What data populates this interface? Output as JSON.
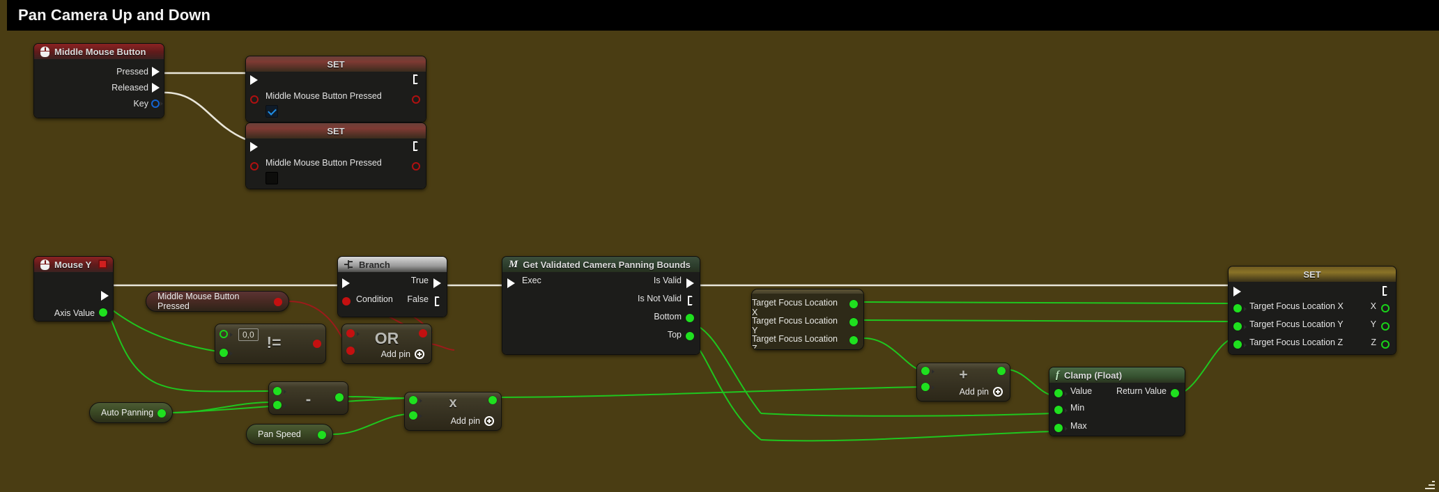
{
  "window": {
    "title": "Pan Camera Up and Down",
    "background_color": "#4a3d13",
    "titlebar_color": "#000000"
  },
  "graph": {
    "nodes": [
      {
        "id": "event-middle-mouse-button",
        "kind": "event",
        "title": "Middle Mouse Button",
        "icon": "mouse-icon",
        "outputs": [
          "Pressed",
          "Released",
          "Key"
        ]
      },
      {
        "id": "set-mmb-pressed-true",
        "kind": "set",
        "title": "SET",
        "variable": "Middle Mouse Button Pressed",
        "checkbox_state": "checked"
      },
      {
        "id": "set-mmb-pressed-false",
        "kind": "set",
        "title": "SET",
        "variable": "Middle Mouse Button Pressed",
        "checkbox_state": "unchecked"
      },
      {
        "id": "event-mouse-y",
        "kind": "event",
        "title": "Mouse Y",
        "icon": "mouse-icon",
        "badge": "stop-icon",
        "outputs": [
          "Axis Value"
        ]
      },
      {
        "id": "getter-mmb-pressed",
        "kind": "variable-get",
        "label": "Middle Mouse Button Pressed",
        "pin_color": "red"
      },
      {
        "id": "getter-auto-panning",
        "kind": "variable-get",
        "label": "Auto Panning",
        "pin_color": "green"
      },
      {
        "id": "getter-pan-speed",
        "kind": "variable-get",
        "label": "Pan Speed",
        "pin_color": "green"
      },
      {
        "id": "node-not-equal",
        "kind": "operator",
        "operator": "!=",
        "value_field": "0,0"
      },
      {
        "id": "node-or",
        "kind": "operator",
        "operator": "OR",
        "add_pin_label": "Add pin"
      },
      {
        "id": "node-subtract",
        "kind": "operator",
        "operator": "-"
      },
      {
        "id": "node-multiply",
        "kind": "operator",
        "operator": "x",
        "add_pin_label": "Add pin"
      },
      {
        "id": "node-add",
        "kind": "operator",
        "operator": "+",
        "add_pin_label": "Add pin"
      },
      {
        "id": "node-branch",
        "kind": "flow",
        "title": "Branch",
        "icon": "branch-icon",
        "inputs": [
          "Condition"
        ],
        "outputs": [
          "True",
          "False"
        ]
      },
      {
        "id": "node-get-validated-camera-panning-bounds",
        "kind": "function",
        "title": "Get Validated Camera Panning Bounds",
        "icon": "macro-icon",
        "inputs": [
          "Exec"
        ],
        "outputs": [
          "Is Valid",
          "Is Not Valid",
          "Bottom",
          "Top"
        ]
      },
      {
        "id": "getter-target-focus-location",
        "kind": "variable-get-group",
        "labels": [
          "Target Focus Location X",
          "Target Focus Location Y",
          "Target Focus Location Z"
        ]
      },
      {
        "id": "node-clamp-float",
        "kind": "function-pure",
        "title": "Clamp (Float)",
        "icon": "function-icon",
        "inputs": [
          "Value",
          "Min",
          "Max"
        ],
        "outputs": [
          "Return Value"
        ]
      },
      {
        "id": "set-target-focus-location",
        "kind": "set",
        "title": "SET",
        "inputs": [
          "Target Focus Location X",
          "Target Focus Location Y",
          "Target Focus Location Z"
        ],
        "outputs": [
          "X",
          "Y",
          "Z"
        ]
      }
    ],
    "labels": {
      "set": "SET",
      "pressed": "Pressed",
      "released": "Released",
      "key": "Key",
      "axis_value": "Axis Value",
      "condition": "Condition",
      "true": "True",
      "false": "False",
      "branch": "Branch",
      "exec": "Exec",
      "is_valid": "Is Valid",
      "is_not_valid": "Is Not Valid",
      "bottom": "Bottom",
      "top": "Top",
      "value": "Value",
      "min": "Min",
      "max": "Max",
      "return_value": "Return Value",
      "add_pin": "Add pin",
      "x": "X",
      "y": "Y",
      "z": "Z",
      "mmb_title": "Middle Mouse Button",
      "mmb_var": "Middle Mouse Button Pressed",
      "mouse_y": "Mouse Y",
      "auto_panning": "Auto Panning",
      "pan_speed": "Pan Speed",
      "clamp_float": "Clamp (Float)",
      "bounds_title": "Get Validated Camera Panning Bounds",
      "tfl_x": "Target Focus Location X",
      "tfl_y": "Target Focus Location Y",
      "tfl_z": "Target Focus Location Z",
      "op_neq": "!=",
      "op_or": "OR",
      "op_sub": "-",
      "op_mul": "x",
      "op_add": "+",
      "val_00": "0,0",
      "macro_glyph": "M",
      "fn_glyph": "f"
    }
  }
}
